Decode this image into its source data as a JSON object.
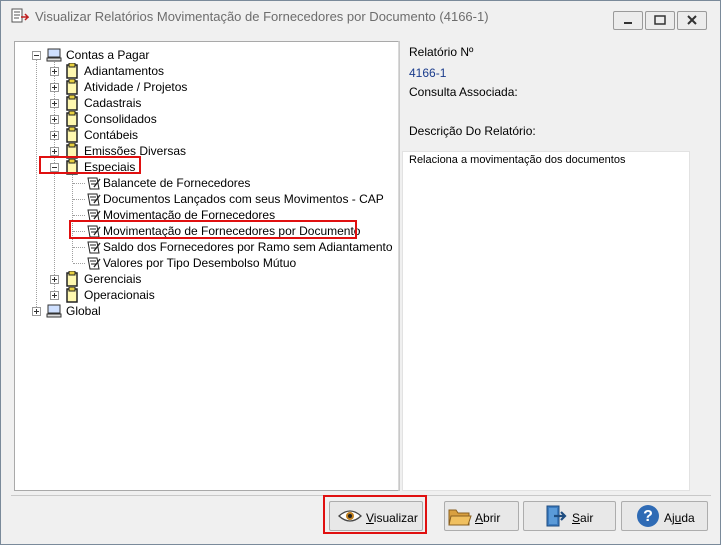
{
  "window": {
    "title": "Visualizar Relatórios Movimentação de Fornecedores por Documento (4166-1)",
    "controls": [
      "minimize",
      "maximize",
      "close"
    ]
  },
  "tree": {
    "root": {
      "label": "Contas a Pagar",
      "icon": "computer-icon",
      "expanded": true,
      "children": [
        {
          "label": "Adiantamentos",
          "icon": "clipboard-icon",
          "expanded": false
        },
        {
          "label": "Atividade / Projetos",
          "icon": "clipboard-icon",
          "expanded": false
        },
        {
          "label": "Cadastrais",
          "icon": "clipboard-icon",
          "expanded": false
        },
        {
          "label": "Consolidados",
          "icon": "clipboard-icon",
          "expanded": false
        },
        {
          "label": "Contábeis",
          "icon": "clipboard-icon",
          "expanded": false
        },
        {
          "label": "Emissões Diversas",
          "icon": "clipboard-icon",
          "expanded": false
        },
        {
          "label": "Especiais",
          "icon": "clipboard-icon",
          "expanded": true,
          "highlighted": true,
          "children": [
            {
              "label": "Balancete de Fornecedores",
              "icon": "report-icon"
            },
            {
              "label": "Documentos Lançados com seus Movimentos - CAP",
              "icon": "report-icon"
            },
            {
              "label": "Movimentação de Fornecedores",
              "icon": "report-icon"
            },
            {
              "label": "Movimentação de Fornecedores por Documento",
              "icon": "report-icon",
              "selected": true,
              "highlighted": true
            },
            {
              "label": "Saldo dos Fornecedores por Ramo sem Adiantamento",
              "icon": "report-icon"
            },
            {
              "label": "Valores por Tipo Desembolso Mútuo",
              "icon": "report-icon"
            }
          ]
        },
        {
          "label": "Gerenciais",
          "icon": "clipboard-icon",
          "expanded": false
        },
        {
          "label": "Operacionais",
          "icon": "clipboard-icon",
          "expanded": false
        }
      ]
    },
    "global": {
      "label": "Global",
      "icon": "computer-icon",
      "expanded": false
    }
  },
  "details": {
    "report_no_label": "Relatório Nº",
    "report_no_value": "4166-1",
    "consulta_label": "Consulta Associada:",
    "descricao_label": "Descrição Do Relatório:",
    "descricao_text": "Relaciona a movimentação dos documentos"
  },
  "buttons": {
    "visualizar": {
      "label_u": "V",
      "label_rest": "isualizar",
      "icon": "eye-icon",
      "highlighted": true
    },
    "abrir": {
      "label_u": "A",
      "label_rest": "brir",
      "icon": "folder-icon"
    },
    "sair": {
      "label_u": "S",
      "label_rest": "air",
      "icon": "exit-icon"
    },
    "ajuda": {
      "label_pre": "Aj",
      "label_u": "u",
      "label_rest": "da",
      "icon": "help-icon"
    }
  },
  "colors": {
    "highlight": "#e01010",
    "value_text": "#1a3c8c",
    "window_bg": "#f0f0f0"
  }
}
